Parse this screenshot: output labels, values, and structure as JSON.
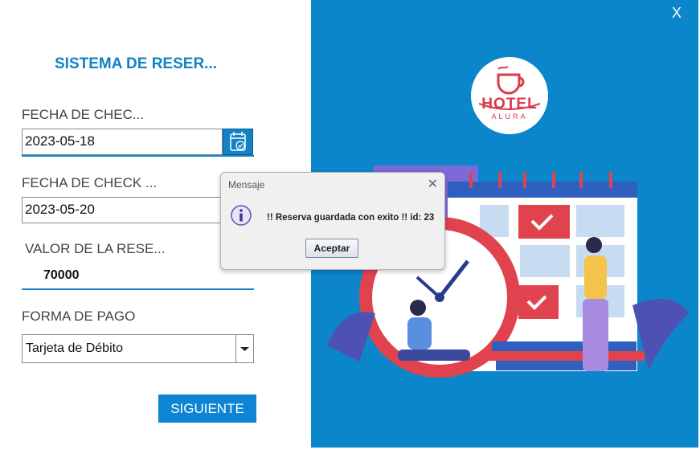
{
  "form": {
    "title": "SISTEMA DE RESER...",
    "checkin_label": "FECHA DE CHEC...",
    "checkin_value": "2023-05-18",
    "checkout_label": "FECHA DE CHECK ...",
    "checkout_value": "2023-05-20",
    "valor_label": "VALOR DE LA RESE...",
    "valor_value": "70000",
    "pago_label": "FORMA DE PAGO",
    "pago_value": "Tarjeta de Débito",
    "next_label": "SIGUIENTE"
  },
  "window": {
    "close_label": "X"
  },
  "logo": {
    "name": "HOTEL",
    "sub": "ALURA"
  },
  "dialog": {
    "title": "Mensaje",
    "message": "!! Reserva guardada con exito !! id: 23",
    "ok_label": "Aceptar"
  },
  "colors": {
    "accent": "#1282c4",
    "panel": "#0c86cb",
    "logo_red": "#d93a4a"
  },
  "icons": [
    "calendar-check-icon",
    "info-icon",
    "chevron-down-icon",
    "close-icon",
    "hotel-logo-icon"
  ]
}
